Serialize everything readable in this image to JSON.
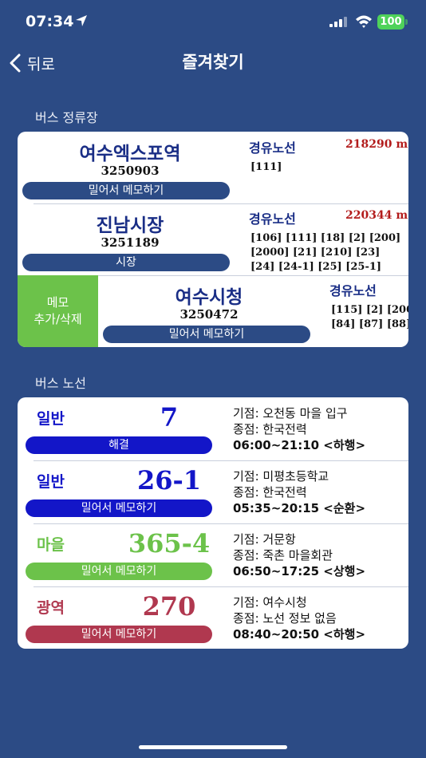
{
  "status_bar": {
    "time": "07:34",
    "battery": "100"
  },
  "nav": {
    "back_label": "뒤로",
    "title": "즐겨찾기"
  },
  "sections": {
    "stops_header": "버스 정류장",
    "lines_header": "버스 노선"
  },
  "stops": [
    {
      "name": "여수엑스포역",
      "code": "3250903",
      "memo": "밀어서 메모하기",
      "route_header": "경유노선",
      "distance": "218290 m",
      "routes": [
        "[111]"
      ]
    },
    {
      "name": "진남시장",
      "code": "3251189",
      "memo": "시장",
      "route_header": "경유노선",
      "distance": "220344 m",
      "routes": [
        "[106] [111] [18] [2] [200]",
        "[2000] [21] [210] [23]",
        "[24] [24-1] [25] [25-1]"
      ]
    },
    {
      "name": "여수시청",
      "code": "3250472",
      "memo": "밀어서 메모하기",
      "route_header": "경유노선",
      "distance": "",
      "routes": [
        "[115] [2] [200",
        "[84] [87] [88]"
      ]
    }
  ],
  "memo_action": {
    "line1": "메모",
    "line2": "추가/삭제"
  },
  "lines": [
    {
      "type": "일반",
      "number": "7",
      "memo": "해결",
      "start": "기점: 오천동 마을 입구",
      "end": "종점: 한국전력",
      "time": "06:00~21:10 <하행>",
      "color": "#1316c8",
      "pill_color": "#1316c8"
    },
    {
      "type": "일반",
      "number": "26-1",
      "memo": "밀어서 메모하기",
      "start": "기점: 미평초등학교",
      "end": "종점: 한국전력",
      "time": "05:35~20:15 <순환>",
      "color": "#1316c8",
      "pill_color": "#1316c8"
    },
    {
      "type": "마을",
      "number": "365-4",
      "memo": "밀어서 메모하기",
      "start": "기점: 거문항",
      "end": "종점: 죽촌 마을회관",
      "time": "06:50~17:25 <상행>",
      "color": "#6cc24a",
      "pill_color": "#6cc24a"
    },
    {
      "type": "광역",
      "number": "270",
      "memo": "밀어서 메모하기",
      "start": "기점: 여수시청",
      "end": "종점: 노선 정보 없음",
      "time": "08:40~20:50 <하행>",
      "color": "#b0384f",
      "pill_color": "#b0384f"
    }
  ]
}
